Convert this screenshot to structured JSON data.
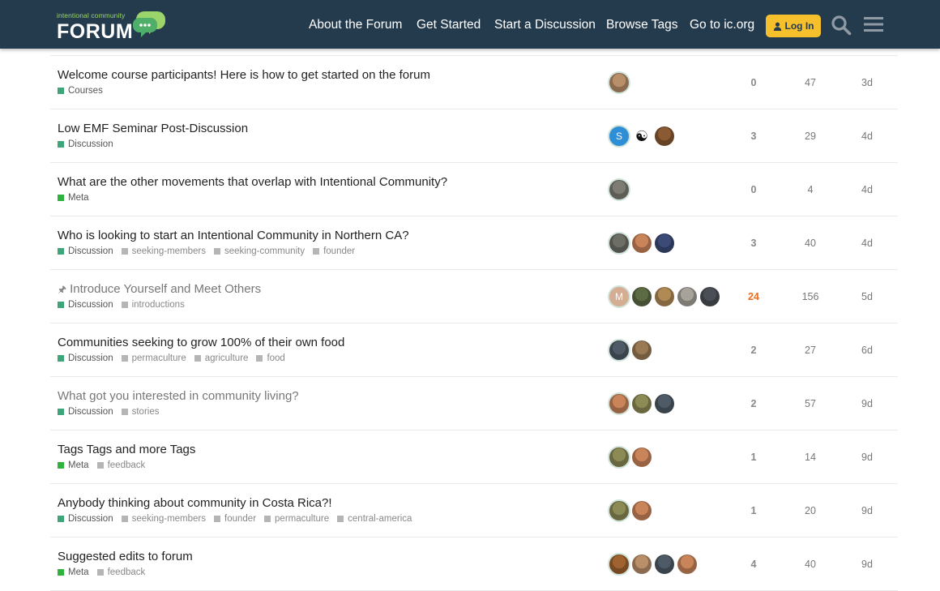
{
  "header": {
    "logo_small": "intentional community",
    "logo_big": "FORUM",
    "nav": [
      "About the Forum",
      "Get Started",
      "Start a Discussion",
      "Browse Tags",
      "Go to ic.org"
    ],
    "login_label": "Log In",
    "icons": {
      "search": "search-icon",
      "menu": "hamburger-menu-icon",
      "login": "user-icon",
      "logo": "chat-bubbles-icon"
    },
    "colors": {
      "bar": "#243b4e",
      "accent": "#f6c02c",
      "logo_green": "#6fbf4a"
    }
  },
  "category_colors": {
    "Courses": "#3ea57a",
    "Discussion": "#3ea57a",
    "Meta": "#2eb33f"
  },
  "topics": [
    {
      "title": "Welcome course participants! Here is how to get started on the forum",
      "visited": false,
      "pinned": false,
      "category": "Courses",
      "tags": [],
      "replies": "0",
      "views": "47",
      "activity": "3d",
      "posters": [
        {
          "initial": "",
          "color": "#b98f6a"
        }
      ]
    },
    {
      "title": "Low EMF Seminar Post-Discussion",
      "visited": false,
      "pinned": false,
      "category": "Discussion",
      "tags": [],
      "replies": "3",
      "views": "29",
      "activity": "4d",
      "posters": [
        {
          "initial": "S",
          "color": "#2f8fd6"
        },
        {
          "initial": "☯",
          "color": "#ffffff"
        },
        {
          "initial": "",
          "color": "#8a5a32"
        }
      ]
    },
    {
      "title": "What are the other movements that overlap with Intentional Community?",
      "visited": false,
      "pinned": false,
      "category": "Meta",
      "tags": [],
      "replies": "0",
      "views": "4",
      "activity": "4d",
      "posters": [
        {
          "initial": "",
          "color": "#7d7d74"
        }
      ]
    },
    {
      "title": "Who is looking to start an Intentional Community in Northern CA?",
      "visited": false,
      "pinned": false,
      "category": "Discussion",
      "tags": [
        "seeking-members",
        "seeking-community",
        "founder"
      ],
      "replies": "3",
      "views": "40",
      "activity": "4d",
      "posters": [
        {
          "initial": "",
          "color": "#6d6f66"
        },
        {
          "initial": "",
          "color": "#c9845a"
        },
        {
          "initial": "",
          "color": "#3b4a76"
        }
      ]
    },
    {
      "title": "Introduce Yourself and Meet Others",
      "visited": true,
      "pinned": true,
      "category": "Discussion",
      "tags": [
        "introductions"
      ],
      "replies": "24",
      "views": "156",
      "activity": "5d",
      "posters": [
        {
          "initial": "M",
          "color": "#d4ad92"
        },
        {
          "initial": "",
          "color": "#5d6b45"
        },
        {
          "initial": "",
          "color": "#b08a55"
        },
        {
          "initial": "",
          "color": "#a7a29a"
        },
        {
          "initial": "",
          "color": "#4a4f55"
        }
      ]
    },
    {
      "title": "Communities seeking to grow 100% of their own food",
      "visited": false,
      "pinned": false,
      "category": "Discussion",
      "tags": [
        "permaculture",
        "agriculture",
        "food"
      ],
      "replies": "2",
      "views": "27",
      "activity": "6d",
      "posters": [
        {
          "initial": "",
          "color": "#4e5a66"
        },
        {
          "initial": "",
          "color": "#9a7a55"
        }
      ]
    },
    {
      "title": "What got you interested in community living?",
      "visited": true,
      "pinned": false,
      "category": "Discussion",
      "tags": [
        "stories"
      ],
      "replies": "2",
      "views": "57",
      "activity": "9d",
      "posters": [
        {
          "initial": "",
          "color": "#c9845a"
        },
        {
          "initial": "",
          "color": "#8c8a55"
        },
        {
          "initial": "",
          "color": "#4e5a66"
        }
      ]
    },
    {
      "title": "Tags Tags and more Tags",
      "visited": false,
      "pinned": false,
      "category": "Meta",
      "tags": [
        "feedback"
      ],
      "replies": "1",
      "views": "14",
      "activity": "9d",
      "posters": [
        {
          "initial": "",
          "color": "#8c8a55"
        },
        {
          "initial": "",
          "color": "#c9845a"
        }
      ]
    },
    {
      "title": "Anybody thinking about community in Costa Rica?!",
      "visited": false,
      "pinned": false,
      "category": "Discussion",
      "tags": [
        "seeking-members",
        "founder",
        "permaculture",
        "central-america"
      ],
      "replies": "1",
      "views": "20",
      "activity": "9d",
      "posters": [
        {
          "initial": "",
          "color": "#8c8a55"
        },
        {
          "initial": "",
          "color": "#c9845a"
        }
      ]
    },
    {
      "title": "Suggested edits to forum",
      "visited": false,
      "pinned": false,
      "category": "Meta",
      "tags": [
        "feedback"
      ],
      "replies": "4",
      "views": "40",
      "activity": "9d",
      "posters": [
        {
          "initial": "",
          "color": "#a0622e"
        },
        {
          "initial": "",
          "color": "#b98f6a"
        },
        {
          "initial": "",
          "color": "#4e5a66"
        },
        {
          "initial": "",
          "color": "#c9845a"
        }
      ]
    }
  ]
}
